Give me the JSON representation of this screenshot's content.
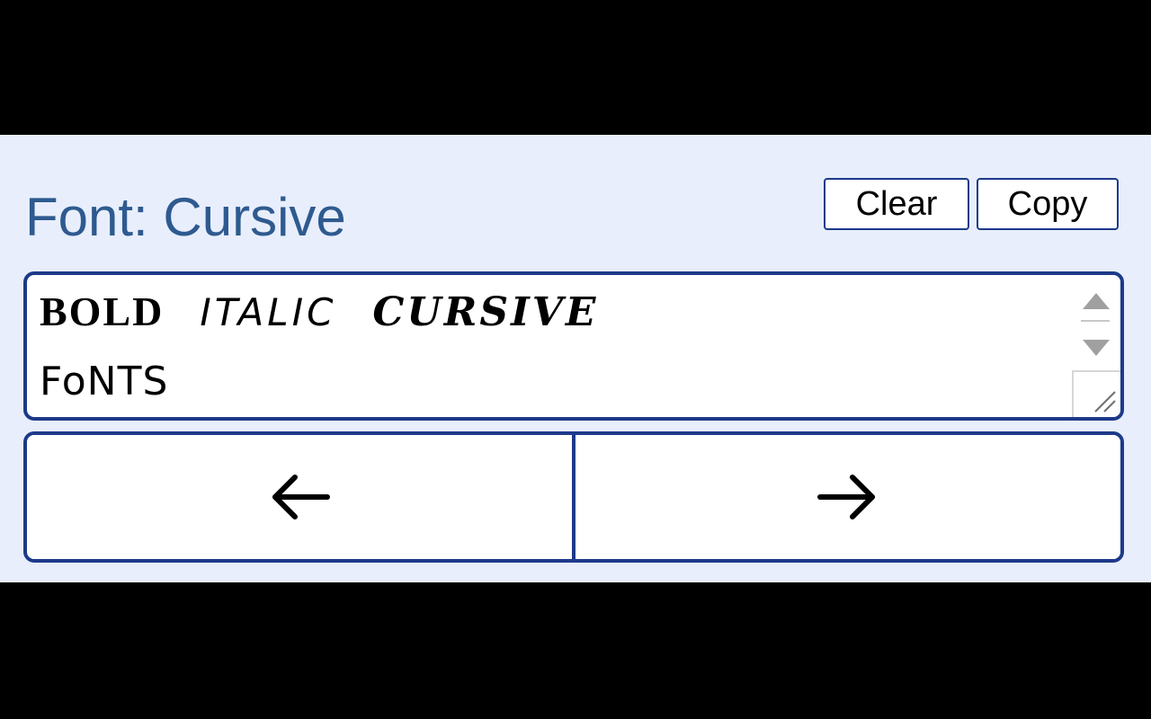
{
  "header": {
    "font_label": "Font: Cursive"
  },
  "toolbar": {
    "clear_label": "Clear",
    "copy_label": "Copy"
  },
  "editor": {
    "segments": {
      "bold": "BOLD",
      "italic": "ITALIC",
      "cursive": "CURSIVE",
      "fonts": "FoNTS"
    },
    "scroll_up_icon": "triangle-up-icon",
    "scroll_down_icon": "triangle-down-icon",
    "resize_icon": "resize-grip-icon"
  },
  "navigation": {
    "prev_icon": "arrow-left-icon",
    "next_icon": "arrow-right-icon"
  },
  "colors": {
    "panel_background": "#e8eefc",
    "border": "#1d3a8a",
    "label_text": "#2e5a8f",
    "letterbox": "#000000"
  }
}
